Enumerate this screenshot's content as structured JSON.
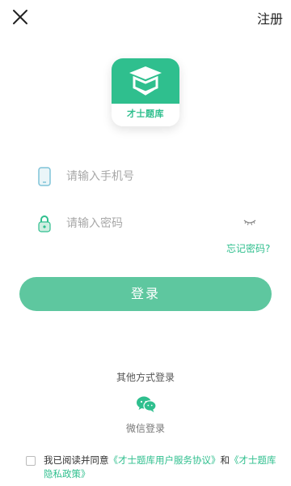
{
  "header": {
    "register_label": "注册"
  },
  "logo": {
    "text": "才士题库"
  },
  "form": {
    "phone_placeholder": "请输入手机号",
    "password_placeholder": "请输入密码",
    "forgot_label": "忘记密码?",
    "login_label": "登录"
  },
  "other_login": {
    "title": "其他方式登录",
    "wechat_label": "微信登录"
  },
  "agreement": {
    "prefix": "我已阅读并同意",
    "user_agreement": "《才士题库用户服务协议》",
    "joiner": "和",
    "privacy_policy": "《才士题库隐私政策》"
  },
  "colors": {
    "accent": "#2fbf8e",
    "button": "#5ec79f"
  },
  "icons": [
    "close-icon",
    "phone-icon",
    "lock-icon",
    "eye-closed-icon",
    "wechat-icon"
  ]
}
